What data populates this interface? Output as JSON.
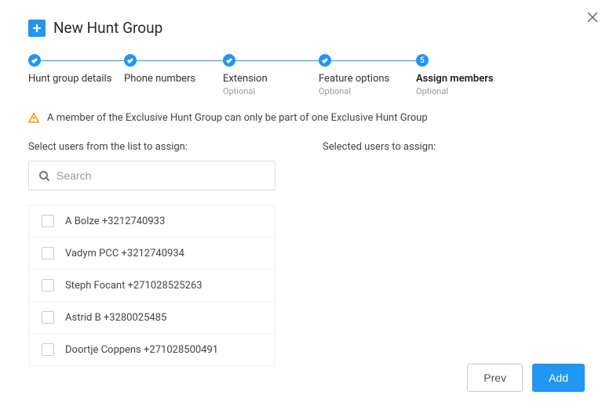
{
  "header": {
    "title": "New Hunt Group"
  },
  "stepper": [
    {
      "label": "Hunt group details",
      "sub": "",
      "done": true,
      "num": null
    },
    {
      "label": "Phone numbers",
      "sub": "",
      "done": true,
      "num": null
    },
    {
      "label": "Extension",
      "sub": "Optional",
      "done": true,
      "num": null
    },
    {
      "label": "Feature options",
      "sub": "Optional",
      "done": true,
      "num": null
    },
    {
      "label": "Assign members",
      "sub": "Optional",
      "done": false,
      "num": "5",
      "active": true
    }
  ],
  "warning": {
    "text": "A member of the Exclusive Hunt Group can only be part of one Exclusive Hunt Group"
  },
  "left": {
    "title": "Select users from the list to assign:",
    "search_placeholder": "Search",
    "users": [
      {
        "label": "A Bolze +3212740933"
      },
      {
        "label": "Vadym PCC +3212740934"
      },
      {
        "label": "Steph Focant +271028525263"
      },
      {
        "label": "Astrid B +3280025485"
      },
      {
        "label": "Doortje Coppens +271028500491"
      }
    ]
  },
  "right": {
    "title": "Selected users to assign:"
  },
  "footer": {
    "prev": "Prev",
    "add": "Add"
  }
}
